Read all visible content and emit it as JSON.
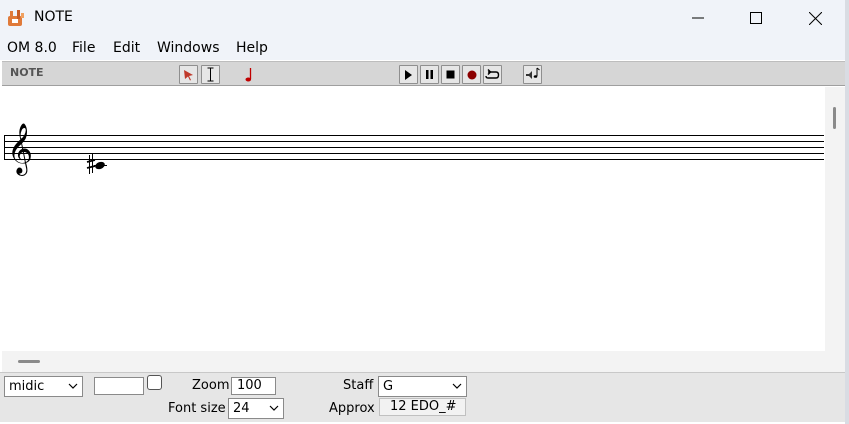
{
  "window": {
    "title": "NOTE"
  },
  "menu": {
    "items": [
      {
        "id": "om",
        "label": "OM 8.0"
      },
      {
        "id": "file",
        "label": "File"
      },
      {
        "id": "edit",
        "label": "Edit"
      },
      {
        "id": "windows",
        "label": "Windows"
      },
      {
        "id": "help",
        "label": "Help"
      }
    ]
  },
  "toolbar": {
    "label": "NOTE",
    "tools": [
      "select-arrow-icon",
      "text-cursor-icon",
      "note-icon"
    ],
    "transport": [
      "play-icon",
      "pause-icon",
      "stop-icon",
      "record-icon",
      "loop-icon",
      "speaker-note-icon"
    ],
    "record_color": "#8b0000",
    "note_color": "#c00000",
    "arrow_color": "#c0392b"
  },
  "score": {
    "clef": "treble",
    "notes": [
      {
        "pitch": "C#4",
        "accidental": "sharp"
      }
    ]
  },
  "bottom": {
    "mode_select": "midic",
    "value_input": "",
    "zoom_label": "Zoom",
    "zoom_value": "100",
    "fontsize_label": "Font size",
    "fontsize_value": "24",
    "staff_label": "Staff",
    "staff_value": "G",
    "approx_label": "Approx",
    "approx_value": "12 EDO_#"
  }
}
